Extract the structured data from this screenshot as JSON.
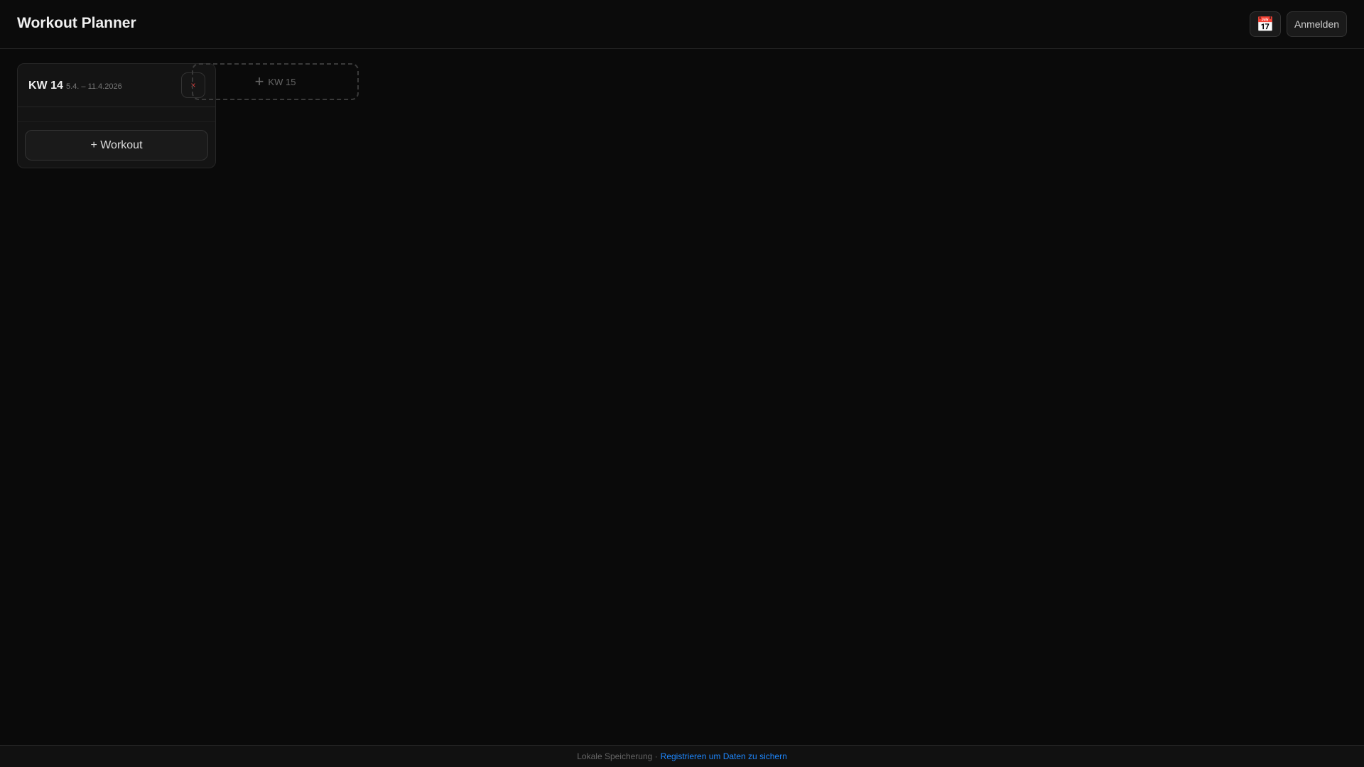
{
  "header": {
    "title": "Workout Planner",
    "calendar_icon": "📅",
    "login_label": "Anmelden"
  },
  "weeks": [
    {
      "label": "KW 14",
      "range": "5.4. – 11.4.2026",
      "delete_icon": "×",
      "add_workout_label": "+ Workout"
    }
  ],
  "add_week": {
    "icon": "+",
    "label": "KW 15"
  },
  "footer": {
    "storage_text": "Lokale Speicherung ·",
    "register_link": "Registrieren um Daten zu sichern"
  },
  "colors": {
    "accent": "#1e88ff",
    "danger": "#e23b3b",
    "background": "#0a0a0a"
  }
}
